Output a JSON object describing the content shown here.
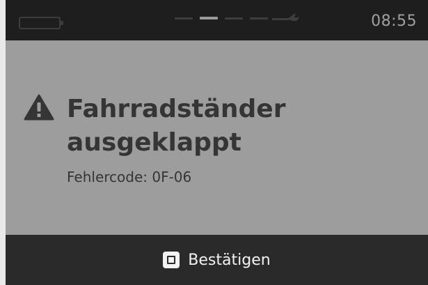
{
  "status_bar": {
    "time": "08:55",
    "icons": [
      "battery-icon",
      "page-indicator",
      "wrench-icon"
    ],
    "active_page_index": 1,
    "page_count": 5
  },
  "alert": {
    "icon": "warning-icon",
    "title": "Fahrradständer ausgeklappt",
    "error_code": "Fehlercode: 0F-06"
  },
  "footer": {
    "confirm_icon": "square-button-icon",
    "confirm_label": "Bestätigen"
  },
  "colors": {
    "status_bar_bg": "#1e1e1e",
    "content_bg": "#9d9d9d",
    "footer_bg": "#2a2a2a",
    "text_dark": "#353535",
    "text_light": "#f2f2f2",
    "clock_text": "#a0a0a0"
  }
}
